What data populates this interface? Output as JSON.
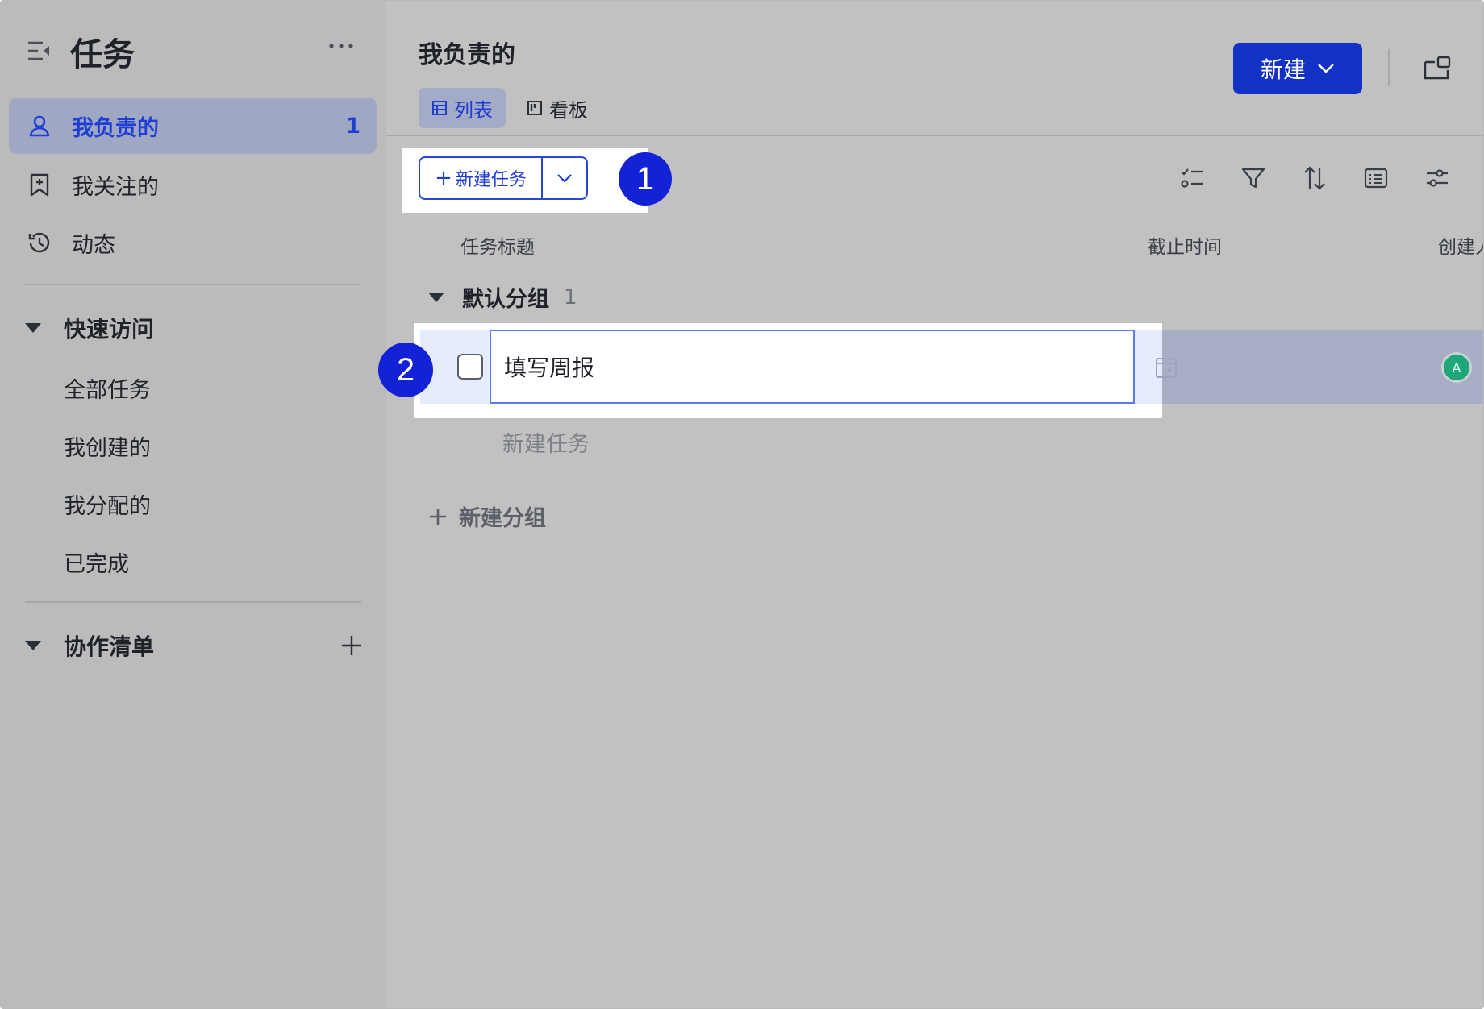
{
  "sidebar": {
    "title": "任务",
    "nav": [
      {
        "label": "我负责的",
        "count": "1",
        "icon": "person-icon",
        "active": true
      },
      {
        "label": "我关注的",
        "icon": "bookmark-plus-icon"
      },
      {
        "label": "动态",
        "icon": "history-icon"
      }
    ],
    "quick_access": {
      "label": "快速访问",
      "items": [
        "全部任务",
        "我创建的",
        "我分配的",
        "已完成"
      ]
    },
    "collab": {
      "label": "协作清单"
    }
  },
  "main": {
    "title": "我负责的",
    "new_button": "新建",
    "tabs": [
      {
        "label": "列表",
        "icon": "table-icon",
        "active": true
      },
      {
        "label": "看板",
        "icon": "kanban-icon"
      }
    ],
    "new_task_button": "新建任务",
    "columns": {
      "title": "任务标题",
      "due": "截止时间",
      "creator": "创建人"
    },
    "group": {
      "name": "默认分组",
      "count": "1"
    },
    "task": {
      "title": "填写周报",
      "avatar": "A"
    },
    "add_task": "新建任务",
    "add_group": "新建分组"
  },
  "callouts": [
    "1",
    "2"
  ],
  "colors": {
    "accent": "#1232c4",
    "callout": "#1322d6",
    "avatar": "#1fa67a"
  }
}
